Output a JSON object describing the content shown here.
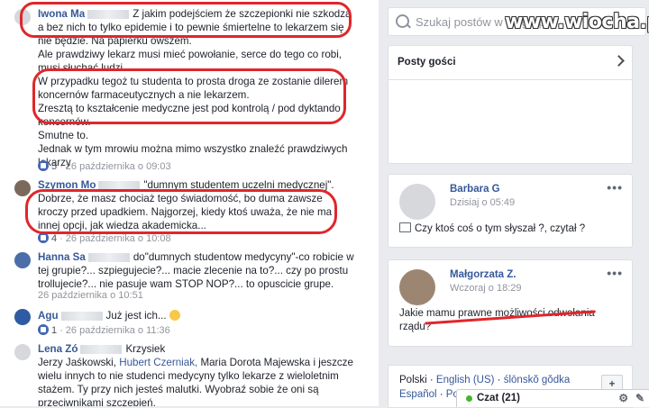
{
  "comments": [
    {
      "name": "Iwona Ma",
      "text": "Z jakim podejściem że szczepionki nie szkodzą a bez nich to tylko epidemie i to pewnie śmiertelne to lekarzem się nie będzie. Na papierku owszem.",
      "text2": "Ale prawdziwy lekarz musi mieć powołanie, serce do tego co robi, musi słuchać ludzi.",
      "text3": "W przypadku tegoż tu studenta to prosta droga ze zostanie dilerem koncernów farmaceutycznych a nie lekarzem.",
      "text4": "Zresztą to kształcenie medyczne jest pod kontrolą / pod dyktando koncernów.",
      "text5": "Smutne to.",
      "text6": "Jednak w tym mrowiu można mimo wszystko znaleźć prawdziwych lekarzy",
      "likes": "5",
      "date": "26 października o 09:03"
    },
    {
      "name": "Szymon Mo",
      "text": "\"dumnym studentem uczelni medycznej\". Dobrze, że masz chociaż tego świadomość, bo duma zawsze kroczy przed upadkiem. Najgorzej, kiedy ktoś uważa, że nie ma innej opcji, jak wiedza akademicka...",
      "likes": "4",
      "date": "26 października o 10:08"
    },
    {
      "name": "Hanna Sa",
      "text": "do\"dumnych studentow medycyny\"-co robicie w tej grupie?... szpiegujecie?... macie zlecenie na to?... czy po prostu trollujecie?... nie pasuje wam STOP NOP?... to opuscicie grupe.",
      "date": "26 października o 10:51"
    },
    {
      "name": "Agu",
      "text": "Już jest ich...",
      "likes": "1",
      "date": "26 października o 11:36"
    },
    {
      "name": "Lena Zó",
      "text": "Krzysiek",
      "text2": "Jerzy Jaśkowski,",
      "link": "Hubert Czerniak,",
      "text3": "Maria Dorota Majewska i jeszcze wielu innych to nie studenci medycyny tylko lekarze z wieloletnim stażem. Ty przy nich jesteś malutki. Wyobraź sobie że oni są przeciwnikami szczepień."
    }
  ],
  "search": {
    "placeholder": "Szukaj postów w tej grupie"
  },
  "watermark": "www.wiocha.pl",
  "guest_posts": {
    "title": "Posty gości"
  },
  "posts": [
    {
      "name": "Barbara G",
      "time": "Dzisiaj o 05:49",
      "text": "Czy ktoś coś o tym słyszał ?, czytał ?"
    },
    {
      "name": "Małgorzata Z.",
      "time": "Wczoraj o 18:29",
      "text": "Jakie mamu prawne możliwości odwołania rządu?"
    }
  ],
  "languages": [
    "Polski",
    "English (US)",
    "ślōnskŏ gŏdka",
    "Español",
    "Por"
  ],
  "chat": {
    "label": "Czat (21)"
  },
  "colors": {
    "link": "#365899",
    "highlight": "#e0262b",
    "online": "#42b72a"
  }
}
